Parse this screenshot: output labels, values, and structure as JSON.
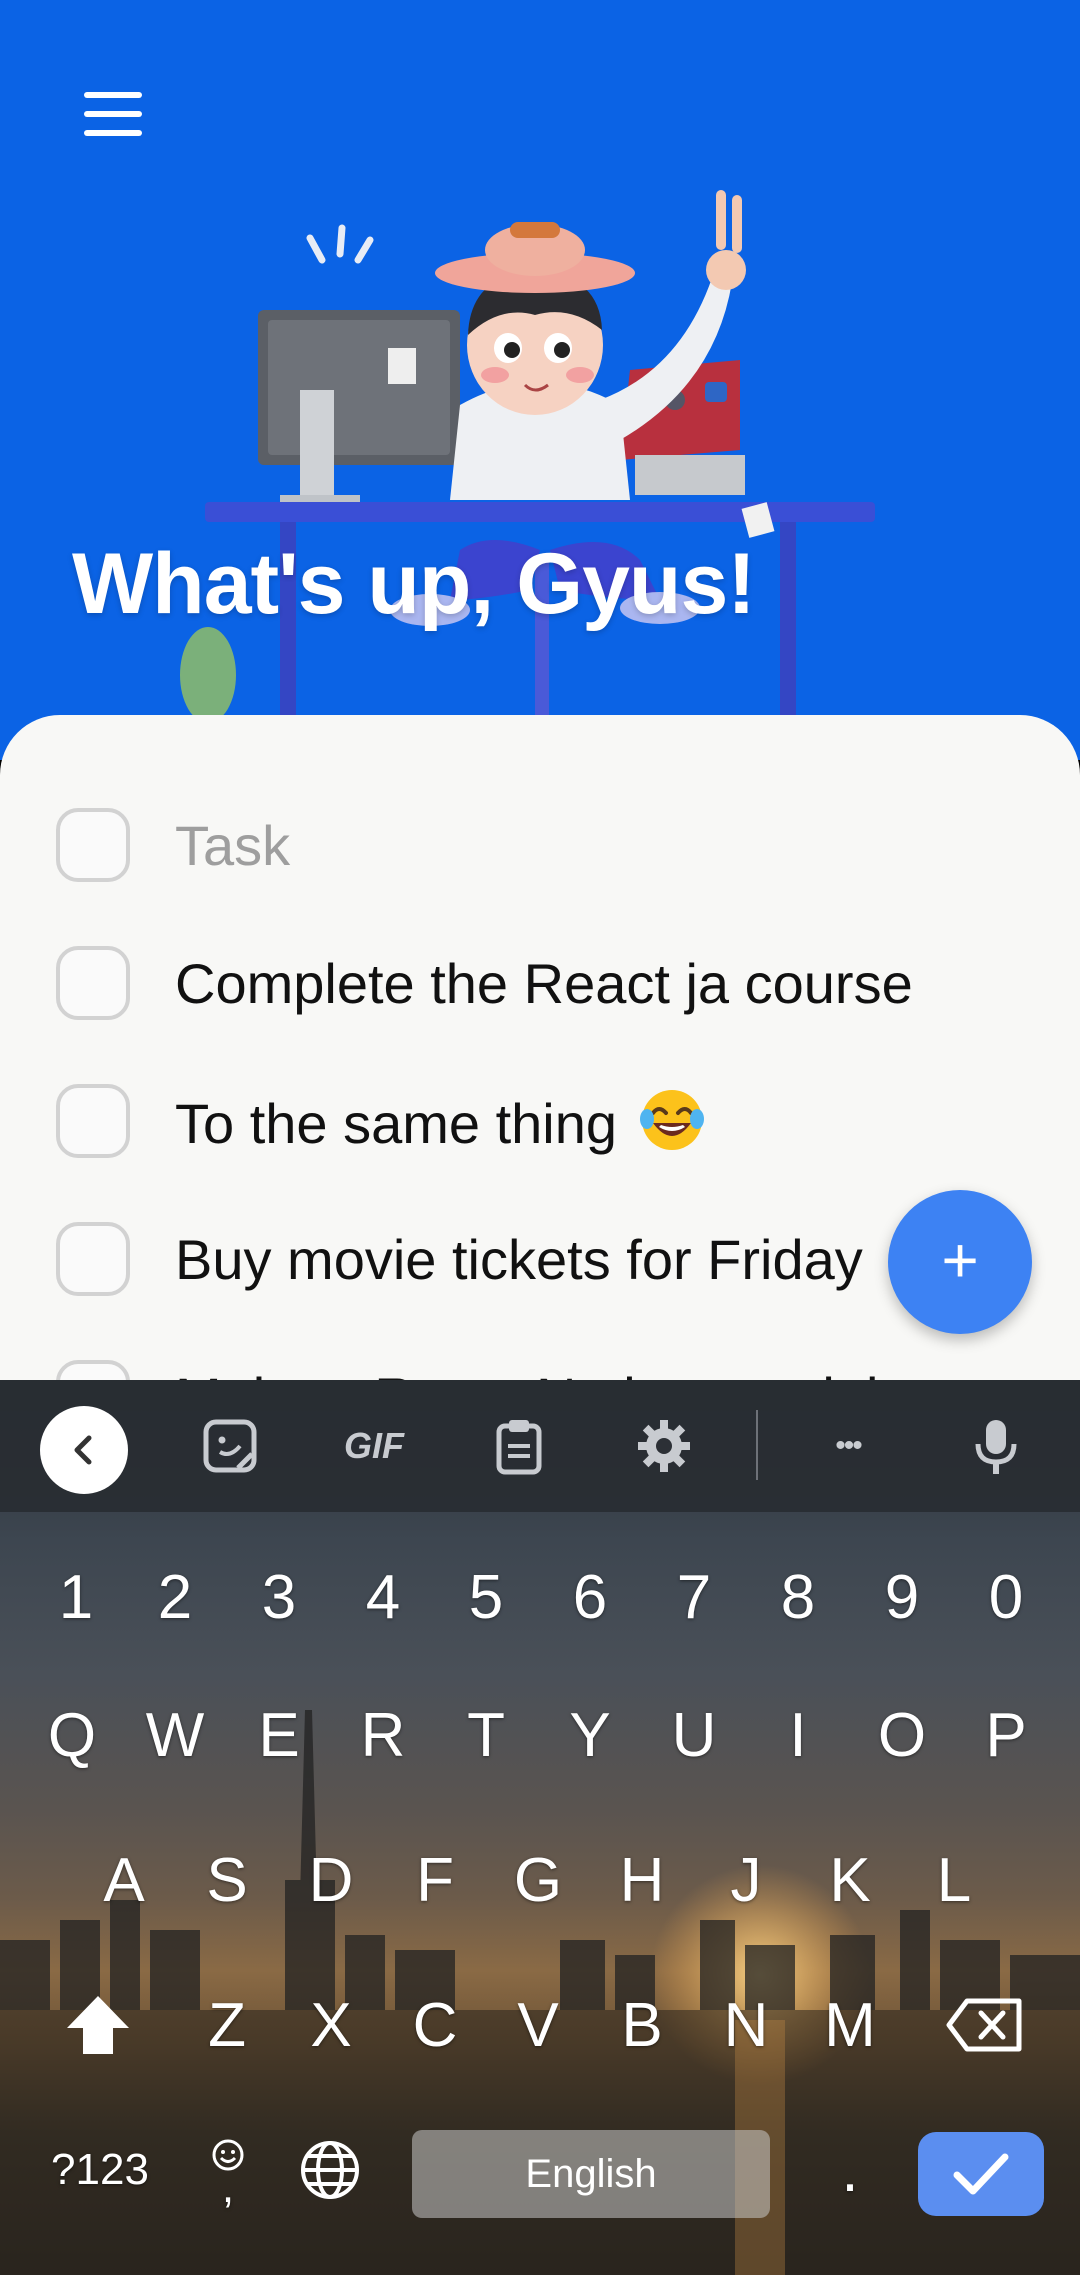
{
  "header": {
    "greeting": "What's up, Gyus!",
    "background_color": "#0b63e5",
    "menu_icon": "hamburger-menu-icon"
  },
  "tasks": {
    "placeholder": "Task",
    "items": [
      {
        "text": "Complete the React ja course",
        "checked": false
      },
      {
        "text": "To the same thing",
        "emoji": "tears-of-joy-emoji",
        "checked": false
      },
      {
        "text": "Buy movie tickets for Friday",
        "checked": false
      },
      {
        "text": "Make a React Native tutorial",
        "checked": false
      }
    ]
  },
  "fab": {
    "label": "+",
    "color": "#3d82f3"
  },
  "keyboard": {
    "toolbar": [
      "back-chevron-icon",
      "sticker-icon",
      "gif-icon",
      "clipboard-icon",
      "settings-icon",
      "more-icon",
      "microphone-icon"
    ],
    "gif_label": "GIF",
    "more_label": "•••",
    "number_row": [
      "1",
      "2",
      "3",
      "4",
      "5",
      "6",
      "7",
      "8",
      "9",
      "0"
    ],
    "row1": [
      "Q",
      "W",
      "E",
      "R",
      "T",
      "Y",
      "U",
      "I",
      "O",
      "P"
    ],
    "row2": [
      "A",
      "S",
      "D",
      "F",
      "G",
      "H",
      "J",
      "K",
      "L"
    ],
    "row3": [
      "Z",
      "X",
      "C",
      "V",
      "B",
      "N",
      "M"
    ],
    "symbols_label": "?123",
    "comma_label": ",",
    "space_label": "English",
    "period_label": ".",
    "accent_color": "#5b8ef0"
  }
}
